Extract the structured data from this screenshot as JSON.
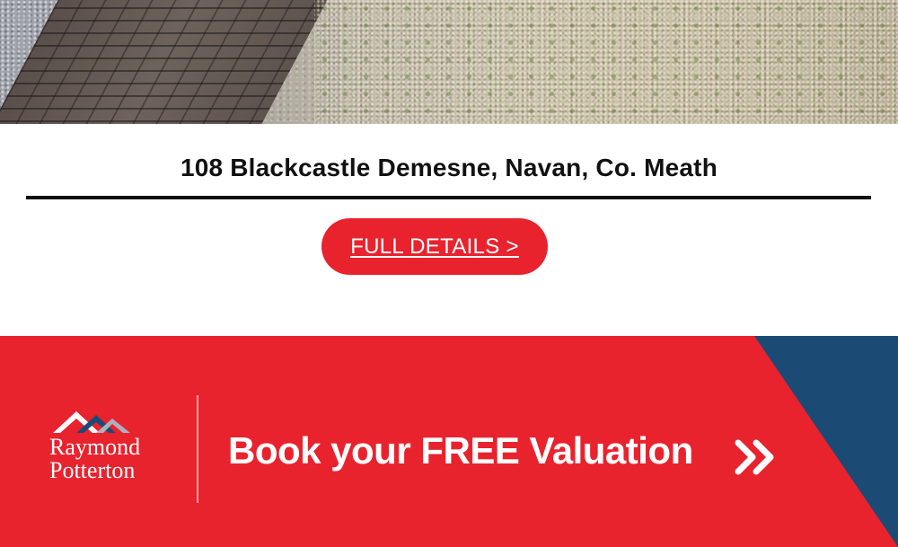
{
  "listing": {
    "address": "108 Blackcastle Demesne, Navan, Co. Meath",
    "cta_label": "FULL DETAILS >"
  },
  "banner": {
    "logo_line1": "Raymond",
    "logo_line2": "Potterton",
    "headline": "Book your FREE Valuation",
    "arrow_icon": "double-chevron-right-icon"
  },
  "colors": {
    "brand_red": "#e8232e",
    "brand_blue": "#1b4b75",
    "text_dark": "#111111"
  }
}
